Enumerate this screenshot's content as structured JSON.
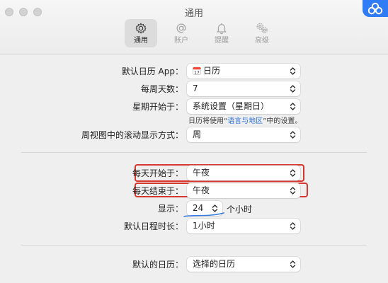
{
  "window": {
    "title": "通用"
  },
  "toolbar": {
    "items": [
      {
        "label": "通用",
        "icon": "gear-icon",
        "active": true
      },
      {
        "label": "账户",
        "icon": "at-icon",
        "active": false
      },
      {
        "label": "提醒",
        "icon": "bell-icon",
        "active": false
      },
      {
        "label": "高级",
        "icon": "gears-icon",
        "active": false
      }
    ]
  },
  "settings": {
    "default_app": {
      "label": "默认日历 App：",
      "value": "日历"
    },
    "days_per_week": {
      "label": "每周天数：",
      "value": "7"
    },
    "week_start": {
      "label": "星期开始于：",
      "value": "系统设置（星期日）",
      "hint_prefix": "日历将使用“",
      "hint_link": "语言与地区",
      "hint_suffix": "”中的设置。"
    },
    "scroll_mode": {
      "label": "周视图中的滚动显示方式：",
      "value": "周"
    },
    "day_start": {
      "label": "每天开始于：",
      "value": "午夜"
    },
    "day_end": {
      "label": "每天结束于：",
      "value": "午夜"
    },
    "show": {
      "label": "显示：",
      "value": "24",
      "suffix": "个小时"
    },
    "default_duration": {
      "label": "默认日程时长：",
      "value": "1小时"
    },
    "default_calendar": {
      "label": "默认的日历：",
      "value": "选择的日历"
    }
  },
  "colors": {
    "accent": "#2f7cf6",
    "highlight": "#d8372f",
    "link": "#2b6fd6"
  }
}
